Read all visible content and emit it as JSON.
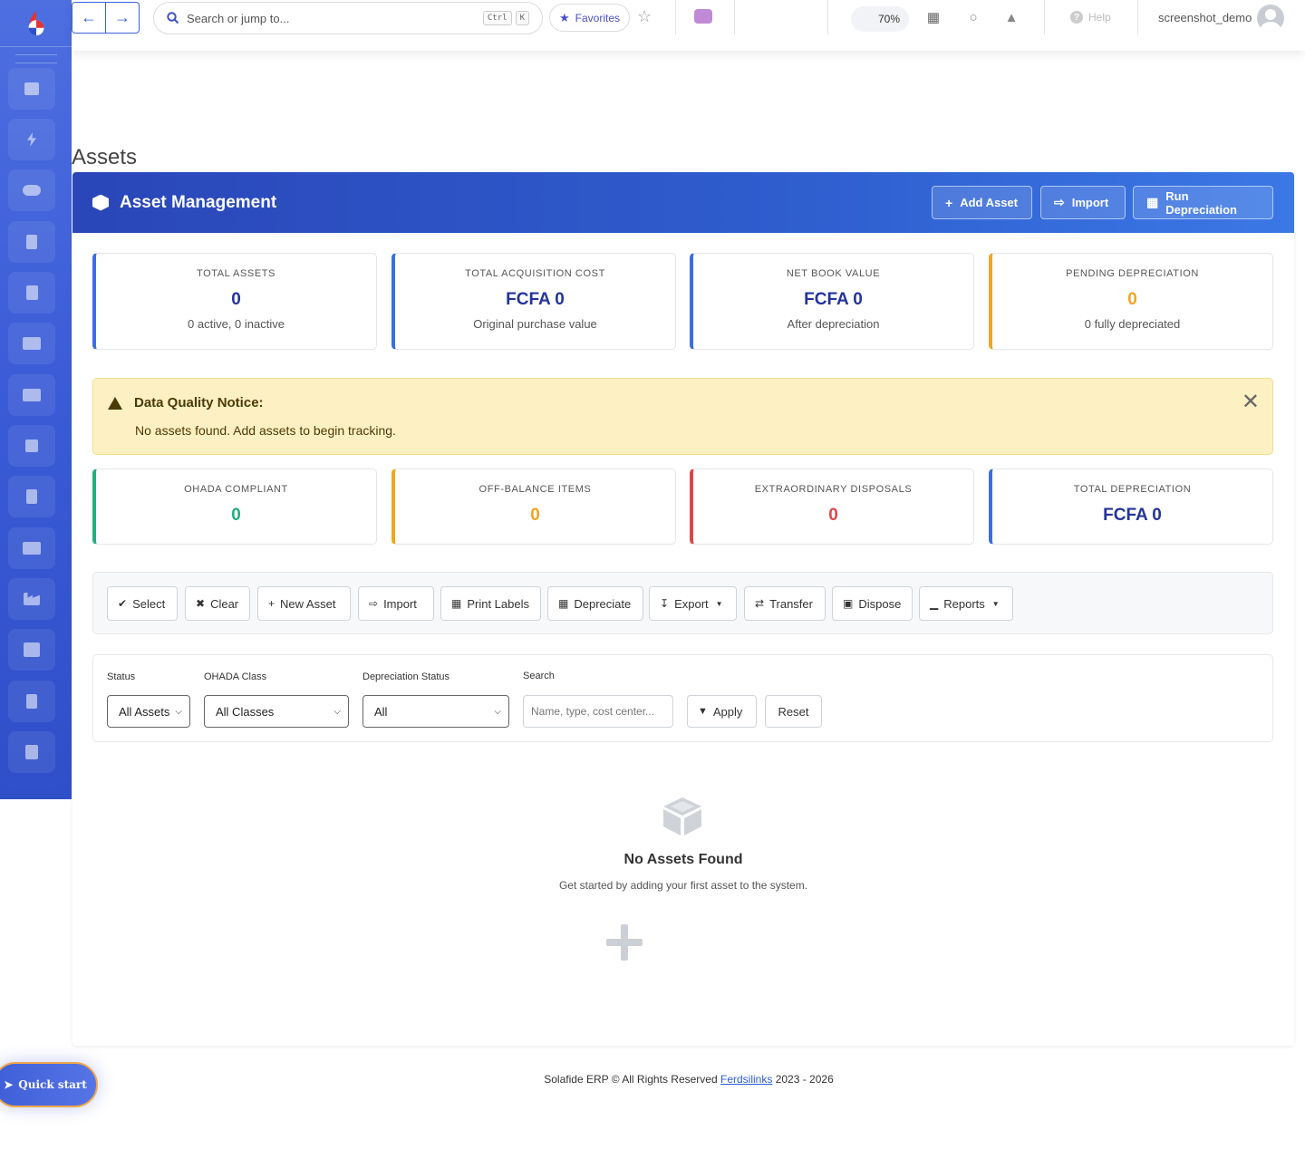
{
  "topbar": {
    "search_placeholder": "Search or jump to...",
    "kbd_ctrl": "Ctrl",
    "kbd_k": "K",
    "favorites_label": "Favorites",
    "zoom_level": "70%",
    "help_label": "Help",
    "username": "screenshot_demo"
  },
  "page": {
    "title": "Assets"
  },
  "header": {
    "title": "Asset Management",
    "add_asset": "Add Asset",
    "import": "Import",
    "run_depreciation": "Run Depreciation"
  },
  "stats": [
    {
      "label": "TOTAL ASSETS",
      "value": "0",
      "sub": "0 active, 0 inactive",
      "accent": "#3b6fe0",
      "value_color": "#23349a"
    },
    {
      "label": "TOTAL ACQUISITION COST",
      "value": "FCFA 0",
      "sub": "Original purchase value",
      "accent": "#3b6fe0",
      "value_color": "#23349a"
    },
    {
      "label": "NET BOOK VALUE",
      "value": "FCFA 0",
      "sub": "After depreciation",
      "accent": "#3b6fe0",
      "value_color": "#23349a"
    },
    {
      "label": "PENDING DEPRECIATION",
      "value": "0",
      "sub": "0 fully depreciated",
      "accent": "#f0a523",
      "value_color": "#f0a523"
    }
  ],
  "alert": {
    "title": "Data Quality Notice:",
    "message": "No assets found. Add assets to begin tracking."
  },
  "stats2": [
    {
      "label": "OHADA COMPLIANT",
      "value": "0",
      "accent": "#22b07d",
      "value_color": "#22b07d"
    },
    {
      "label": "OFF-BALANCE ITEMS",
      "value": "0",
      "accent": "#f0a523",
      "value_color": "#f0a523"
    },
    {
      "label": "EXTRAORDINARY DISPOSALS",
      "value": "0",
      "accent": "#e04646",
      "value_color": "#e04646"
    },
    {
      "label": "TOTAL DEPRECIATION",
      "value": "FCFA 0",
      "accent": "#3b6fe0",
      "value_color": "#23349a"
    }
  ],
  "toolbar": {
    "select": "Select",
    "clear": "Clear",
    "new_asset": "New Asset",
    "import": "Import",
    "print_labels": "Print Labels",
    "depreciate": "Depreciate",
    "export": "Export",
    "transfer": "Transfer",
    "dispose": "Dispose",
    "reports": "Reports"
  },
  "filters": {
    "status_label": "Status",
    "status_value": "All Assets",
    "class_label": "OHADA Class",
    "class_value": "All Classes",
    "dep_label": "Depreciation Status",
    "dep_value": "All",
    "search_label": "Search",
    "search_placeholder": "Name, type, cost center...",
    "apply": "Apply",
    "reset": "Reset"
  },
  "empty": {
    "title": "No Assets Found",
    "subtitle": "Get started by adding your first asset to the system."
  },
  "footer": {
    "text_before": "Solafide ERP © All Rights Reserved",
    "link": "Ferdsilinks",
    "text_after": "2023 - 2026"
  },
  "quick_start": "Quick start",
  "icons": {
    "sidebar": [
      "calculator-icon",
      "bolt-icon",
      "handshake-icon",
      "document-icon",
      "contact-icon",
      "boxes-icon",
      "store-icon",
      "bag-icon",
      "receipt-icon",
      "warehouse-icon",
      "industry-icon",
      "bank-icon",
      "building-icon",
      "book-icon"
    ]
  }
}
